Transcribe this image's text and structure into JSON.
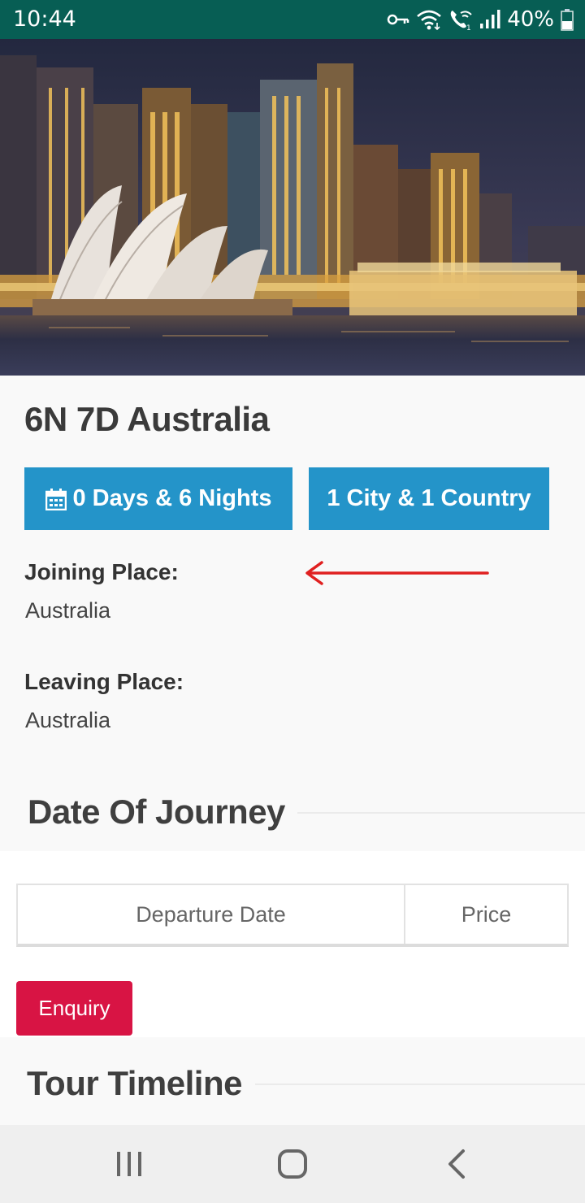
{
  "status_bar": {
    "time": "10:44",
    "battery": "40%",
    "icons": [
      "vpn-key-icon",
      "wifi-icon",
      "wifi-calling-icon",
      "signal-icon",
      "battery-icon"
    ]
  },
  "hero": {
    "image": "sydney-opera-house-night-skyline"
  },
  "tour": {
    "title": "6N 7D Australia",
    "duration_label": "0 Days & 6 Nights",
    "duration_icon": "calendar-icon",
    "locations_label": "1 City & 1 Country",
    "joining_label": "Joining Place:",
    "joining_value": "Australia",
    "leaving_label": "Leaving Place:",
    "leaving_value": "Australia"
  },
  "journey": {
    "section_title": "Date Of Journey",
    "columns": [
      "Departure Date",
      "Price"
    ]
  },
  "enquiry_label": "Enquiry",
  "timeline": {
    "section_title": "Tour Timeline"
  },
  "annotation": {
    "arrow_color": "#e02020"
  },
  "colors": {
    "status_bar": "#075e54",
    "info_button": "#2494c9",
    "enquiry_button": "#d81444"
  },
  "nav_bar": {
    "icons": [
      "recent-apps-icon",
      "home-icon",
      "back-icon"
    ]
  }
}
